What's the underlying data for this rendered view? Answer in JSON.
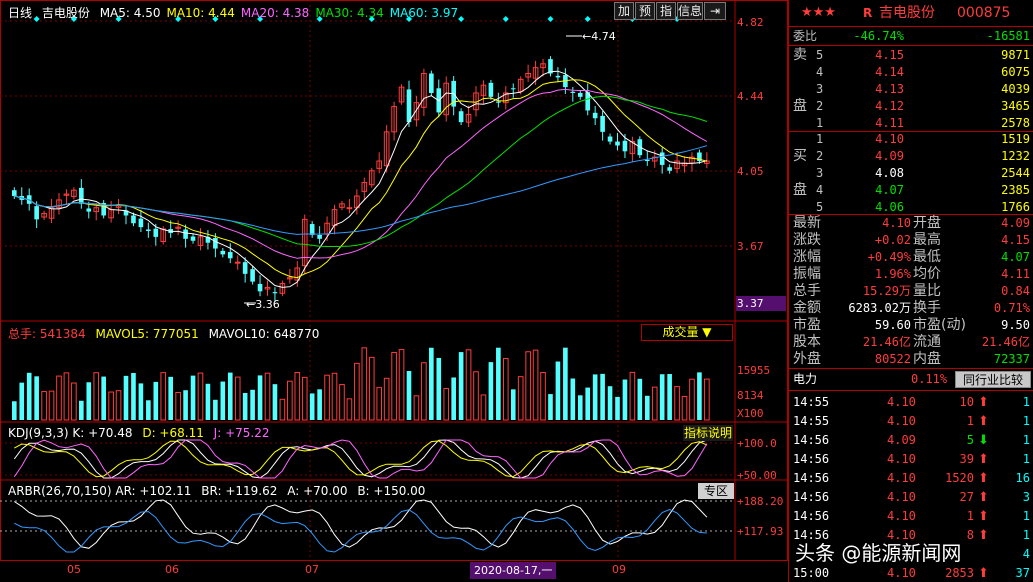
{
  "header": {
    "period": "日线",
    "stock_name": "吉电股份",
    "ma": [
      {
        "label": "MA5: 4.50",
        "color": "#ffffff"
      },
      {
        "label": "MA10: 4.44",
        "color": "#ffff00"
      },
      {
        "label": "MA20: 4.38",
        "color": "#ff66ff"
      },
      {
        "label": "MA30: 4.34",
        "color": "#00e000"
      },
      {
        "label": "MA60: 3.97",
        "color": "#00ffff"
      }
    ],
    "buttons": [
      "加",
      "预",
      "指",
      "信息"
    ],
    "collapse_icon": "collapse-arrow-icon"
  },
  "price_axis": [
    "4.82",
    "4.44",
    "4.05",
    "3.67",
    "3.37"
  ],
  "annotations": {
    "high": "4.74",
    "low": "3.36"
  },
  "volume": {
    "labels": [
      "总手: 541384",
      "MAVOL5: 777051",
      "MAVOL10: 648770"
    ],
    "type_button": "成交量 ▼",
    "axis": [
      "15955",
      "8134",
      "X100"
    ]
  },
  "kdj": {
    "labels": [
      "KDJ(9,3,3) K: +70.48",
      "D: +68.11",
      "J: +75.22"
    ],
    "help_button": "指标说明",
    "axis": [
      "+100.0",
      "+50.00"
    ]
  },
  "arbr": {
    "labels": [
      "ARBR(26,70,150) AR: +102.11",
      "BR: +119.62",
      "A: +70.00",
      "B: +150.00"
    ],
    "zone_button": "专区",
    "axis": [
      "+188.20",
      "+117.93"
    ]
  },
  "x_axis": {
    "labels": [
      "05",
      "06",
      "07",
      "09"
    ],
    "cursor_date": "2020-08-17,一"
  },
  "chart_data": {
    "type": "candlestick",
    "title": "吉电股份",
    "ylim": [
      3.37,
      4.82
    ],
    "close": [
      3.92,
      3.9,
      3.88,
      3.8,
      3.83,
      3.86,
      3.9,
      3.93,
      3.95,
      3.88,
      3.84,
      3.86,
      3.82,
      3.85,
      3.87,
      3.82,
      3.78,
      3.76,
      3.74,
      3.71,
      3.75,
      3.73,
      3.76,
      3.7,
      3.69,
      3.71,
      3.68,
      3.65,
      3.62,
      3.6,
      3.58,
      3.52,
      3.48,
      3.43,
      3.45,
      3.42,
      3.47,
      3.5,
      3.55,
      3.8,
      3.72,
      3.7,
      3.78,
      3.85,
      3.88,
      3.86,
      3.92,
      3.99,
      4.05,
      4.1,
      4.25,
      4.38,
      4.48,
      4.3,
      4.4,
      4.55,
      4.45,
      4.35,
      4.5,
      4.38,
      4.3,
      4.34,
      4.45,
      4.49,
      4.43,
      4.4,
      4.45,
      4.47,
      4.52,
      4.55,
      4.58,
      4.6,
      4.55,
      4.53,
      4.48,
      4.45,
      4.43,
      4.36,
      4.32,
      4.25,
      4.2,
      4.18,
      4.15,
      4.2,
      4.13,
      4.1,
      4.12,
      4.08,
      4.05,
      4.1,
      4.09,
      4.12,
      4.1,
      4.1
    ]
  },
  "panel": {
    "stars": "★★★",
    "r_badge": "R",
    "name": "吉电股份",
    "code": "000875",
    "weibi": {
      "label": "委比",
      "pct": "-46.74%",
      "diff": "-16581"
    },
    "sell": [
      {
        "grp": "卖",
        "lv": "5",
        "price": "4.15",
        "vol": "9871"
      },
      {
        "grp": "",
        "lv": "4",
        "price": "4.14",
        "vol": "6075"
      },
      {
        "grp": "",
        "lv": "3",
        "price": "4.13",
        "vol": "4039"
      },
      {
        "grp": "盘",
        "lv": "2",
        "price": "4.12",
        "vol": "3465"
      },
      {
        "grp": "",
        "lv": "1",
        "price": "4.11",
        "vol": "2578"
      }
    ],
    "buy": [
      {
        "grp": "",
        "lv": "1",
        "price": "4.10",
        "vol": "1519"
      },
      {
        "grp": "买",
        "lv": "2",
        "price": "4.09",
        "vol": "1232"
      },
      {
        "grp": "",
        "lv": "3",
        "price": "4.08",
        "vol": "2544"
      },
      {
        "grp": "盘",
        "lv": "4",
        "price": "4.07",
        "vol": "2385"
      },
      {
        "grp": "",
        "lv": "5",
        "price": "4.06",
        "vol": "1766"
      }
    ],
    "stats": [
      {
        "l1": "最新",
        "v1": "4.10",
        "c1": "#ff3c3c",
        "l2": "开盘",
        "v2": "4.09",
        "c2": "#ff3c3c"
      },
      {
        "l1": "涨跌",
        "v1": "+0.02",
        "c1": "#ff3c3c",
        "l2": "最高",
        "v2": "4.15",
        "c2": "#ff3c3c"
      },
      {
        "l1": "涨幅",
        "v1": "+0.49%",
        "c1": "#ff3c3c",
        "l2": "最低",
        "v2": "4.07",
        "c2": "#00e000"
      },
      {
        "l1": "振幅",
        "v1": "1.96%",
        "c1": "#ff3c3c",
        "l2": "均价",
        "v2": "4.11",
        "c2": "#ff3c3c"
      },
      {
        "l1": "总手",
        "v1": "15.29万",
        "c1": "#ff3c3c",
        "l2": "量比",
        "v2": "0.84",
        "c2": "#ff3c3c"
      },
      {
        "l1": "金额",
        "v1": "6283.02万",
        "c1": "#ffffff",
        "l2": "换手",
        "v2": "0.71%",
        "c2": "#ff3c3c"
      },
      {
        "l1": "市盈",
        "v1": "59.60",
        "c1": "#ffffff",
        "l2": "市盈(动)",
        "v2": "9.50",
        "c2": "#ffffff"
      },
      {
        "l1": "股本",
        "v1": "21.46亿",
        "c1": "#ff3c3c",
        "l2": "流通",
        "v2": "21.46亿",
        "c2": "#ff3c3c"
      },
      {
        "l1": "外盘",
        "v1": "80522",
        "c1": "#ff3c3c",
        "l2": "内盘",
        "v2": "72337",
        "c2": "#00e000"
      }
    ],
    "power": {
      "label": "电力",
      "pct": "0.11%",
      "button": "同行业比较"
    },
    "ticks": [
      {
        "time": "14:55",
        "price": "4.10",
        "vol": "10",
        "dir": "up",
        "n": "1"
      },
      {
        "time": "14:55",
        "price": "4.10",
        "vol": "1",
        "dir": "up",
        "n": "1"
      },
      {
        "time": "14:56",
        "price": "4.09",
        "vol": "5",
        "dir": "down",
        "n": "1"
      },
      {
        "time": "14:56",
        "price": "4.10",
        "vol": "39",
        "dir": "up",
        "n": "1"
      },
      {
        "time": "14:56",
        "price": "4.10",
        "vol": "1520",
        "dir": "up",
        "n": "16"
      },
      {
        "time": "14:56",
        "price": "4.10",
        "vol": "27",
        "dir": "up",
        "n": "3"
      },
      {
        "time": "14:56",
        "price": "4.10",
        "vol": "1",
        "dir": "up",
        "n": "1"
      },
      {
        "time": "14:56",
        "price": "4.10",
        "vol": "8",
        "dir": "up",
        "n": "1"
      },
      {
        "time": "",
        "price": "",
        "vol": "",
        "dir": "",
        "n": "4"
      },
      {
        "time": "15:00",
        "price": "4.10",
        "vol": "2853",
        "dir": "up",
        "n": "37"
      }
    ],
    "watermark": "头条 @能源新闻网"
  }
}
